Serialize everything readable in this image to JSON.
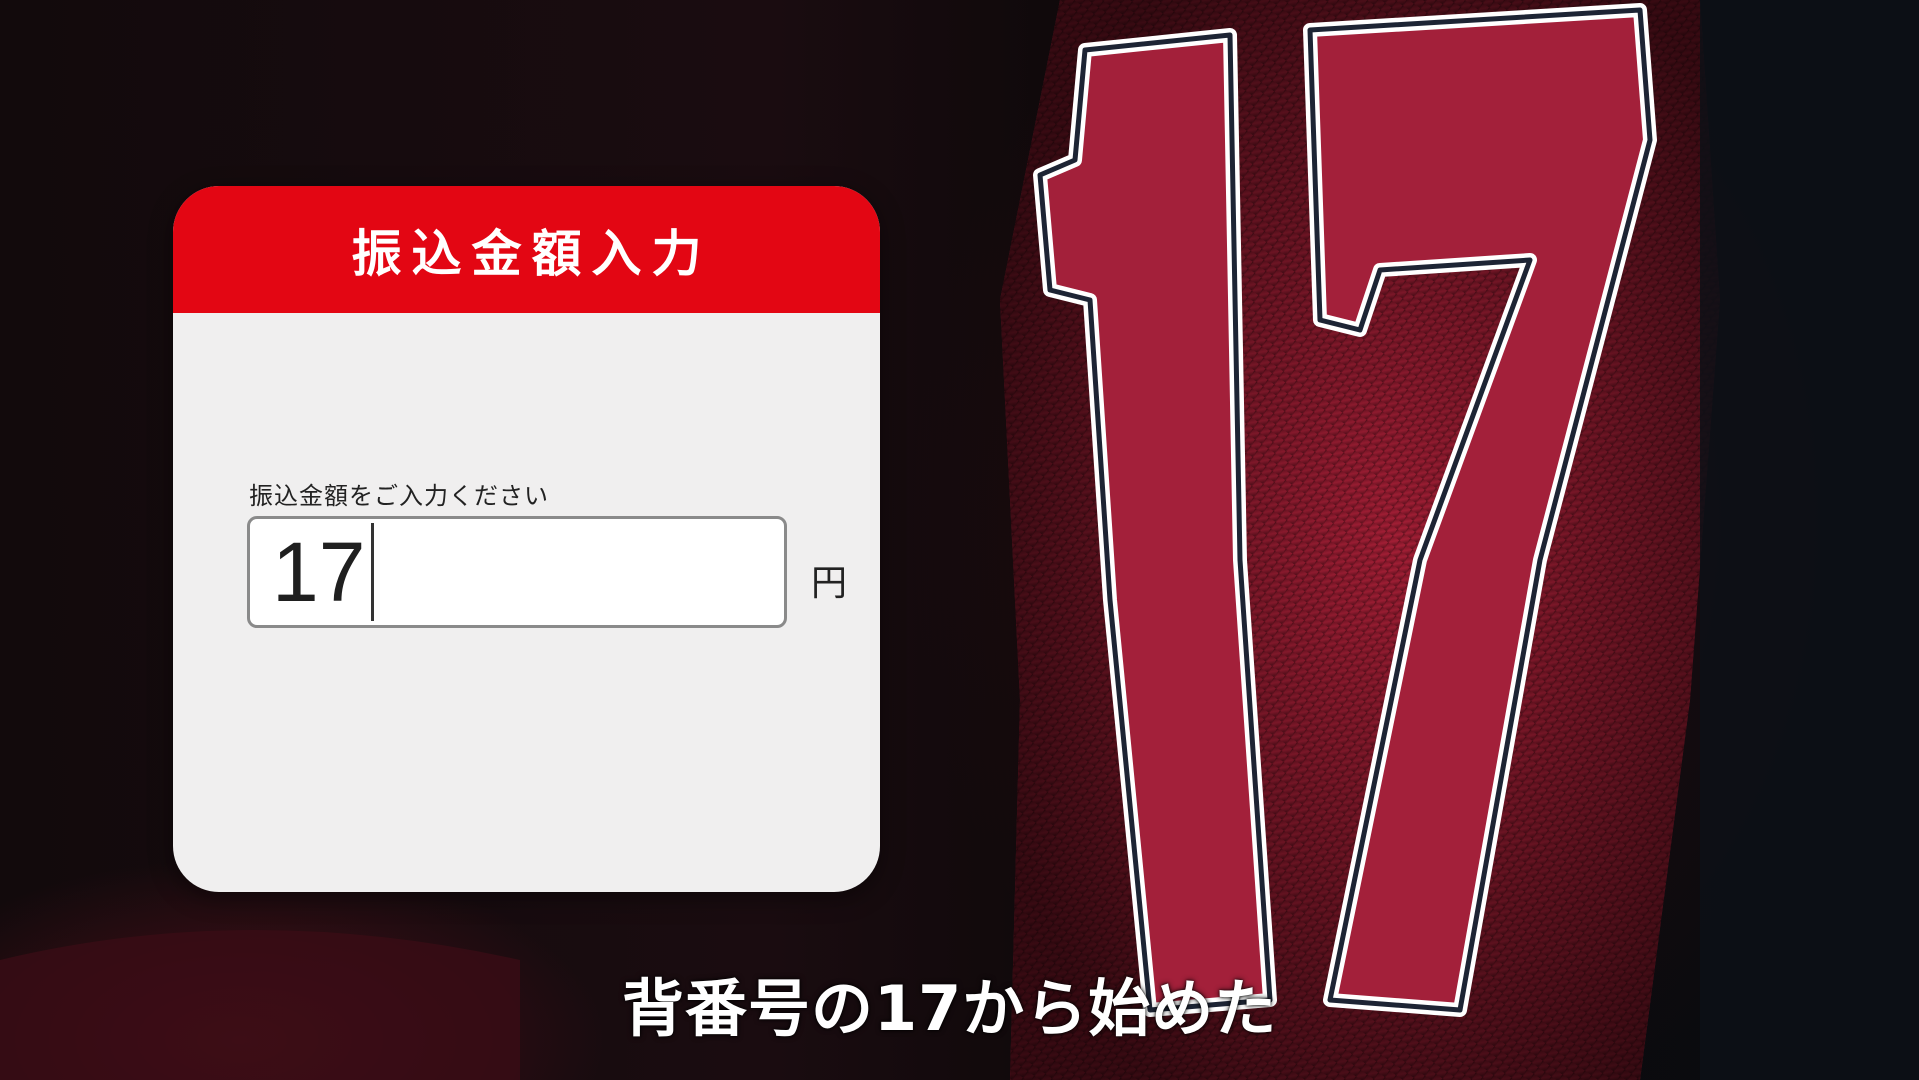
{
  "dialog": {
    "title": "振込金額入力",
    "field_label": "振込金額をご入力ください",
    "amount_value": "17",
    "unit": "円"
  },
  "jersey": {
    "number": "17"
  },
  "subtitle": "背番号の17から始めた",
  "colors": {
    "header_red": "#e30613",
    "jersey_red": "#9e1b32",
    "card_bg": "#f0efef"
  }
}
